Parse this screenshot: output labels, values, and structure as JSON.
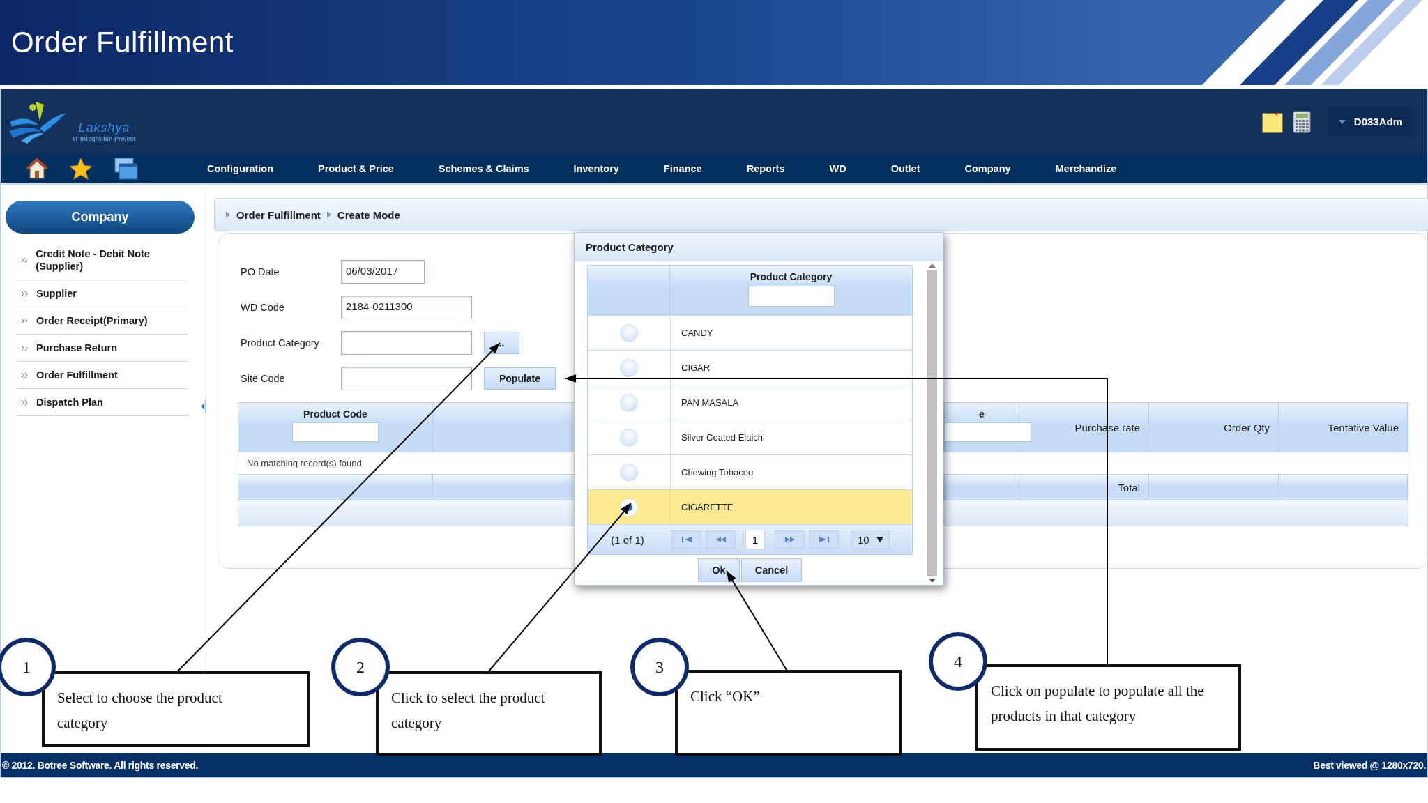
{
  "slide": {
    "title": "Order Fulfillment"
  },
  "app_header": {
    "logo": {
      "name": "Lakshya",
      "tagline": "- IT Integration Project -"
    },
    "user": "D033Adm",
    "nav": [
      "Configuration",
      "Product & Price",
      "Schemes & Claims",
      "Inventory",
      "Finance",
      "Reports",
      "WD",
      "Outlet",
      "Company",
      "Merchandize"
    ]
  },
  "sidebar": {
    "heading": "Company",
    "items": [
      {
        "label": "Credit Note - Debit Note (Supplier)"
      },
      {
        "label": "Supplier"
      },
      {
        "label": "Order Receipt(Primary)"
      },
      {
        "label": "Purchase Return"
      },
      {
        "label": "Order Fulfillment"
      },
      {
        "label": "Dispatch Plan"
      }
    ]
  },
  "breadcrumb": [
    "Order Fulfillment",
    "Create Mode"
  ],
  "form": {
    "fields": [
      {
        "kind": "date",
        "label": "PO Date",
        "value": "06/03/2017"
      },
      {
        "kind": "text",
        "label": "WD Code",
        "value": "2184-0211300"
      },
      {
        "kind": "lookup",
        "label": "Product Category",
        "button": ".."
      },
      {
        "kind": "text",
        "label": "Site Code",
        "button": "Populate"
      }
    ]
  },
  "grid": {
    "columns": [
      {
        "header": "Product Code",
        "filter": true
      },
      {
        "header": "e",
        "filter": true
      },
      {
        "header": "Purchase rate",
        "filter": false
      },
      {
        "header": "Order Qty",
        "filter": false
      },
      {
        "header": "Tentative Value",
        "filter": false
      }
    ],
    "empty_message": "No matching record(s) found",
    "total_label": "Total"
  },
  "dialog": {
    "title": "Product Category",
    "column": "Product Category",
    "rows": [
      {
        "label": "CANDY",
        "selected": false
      },
      {
        "label": "CIGAR",
        "selected": false
      },
      {
        "label": "PAN MASALA",
        "selected": false
      },
      {
        "label": "Silver Coated Elaichi",
        "selected": false
      },
      {
        "label": "Chewing Tobacoo",
        "selected": false
      },
      {
        "label": "CIGARETTE",
        "selected": true
      }
    ],
    "pager": {
      "status": "(1 of 1)",
      "page": "1",
      "page_size": "10"
    },
    "buttons": [
      "Ok",
      "Cancel"
    ]
  },
  "callouts": [
    {
      "number": "1",
      "text": "Select to choose the product category"
    },
    {
      "number": "2",
      "text": "Click to select the product category"
    },
    {
      "number": "3",
      "text": "Click “OK”"
    },
    {
      "number": "4",
      "text": "Click on populate to populate all the products in that category"
    }
  ],
  "footer": {
    "copyright": "© 2012. Botree Software. All rights reserved.",
    "note": "Best viewed @ 1280x720."
  }
}
